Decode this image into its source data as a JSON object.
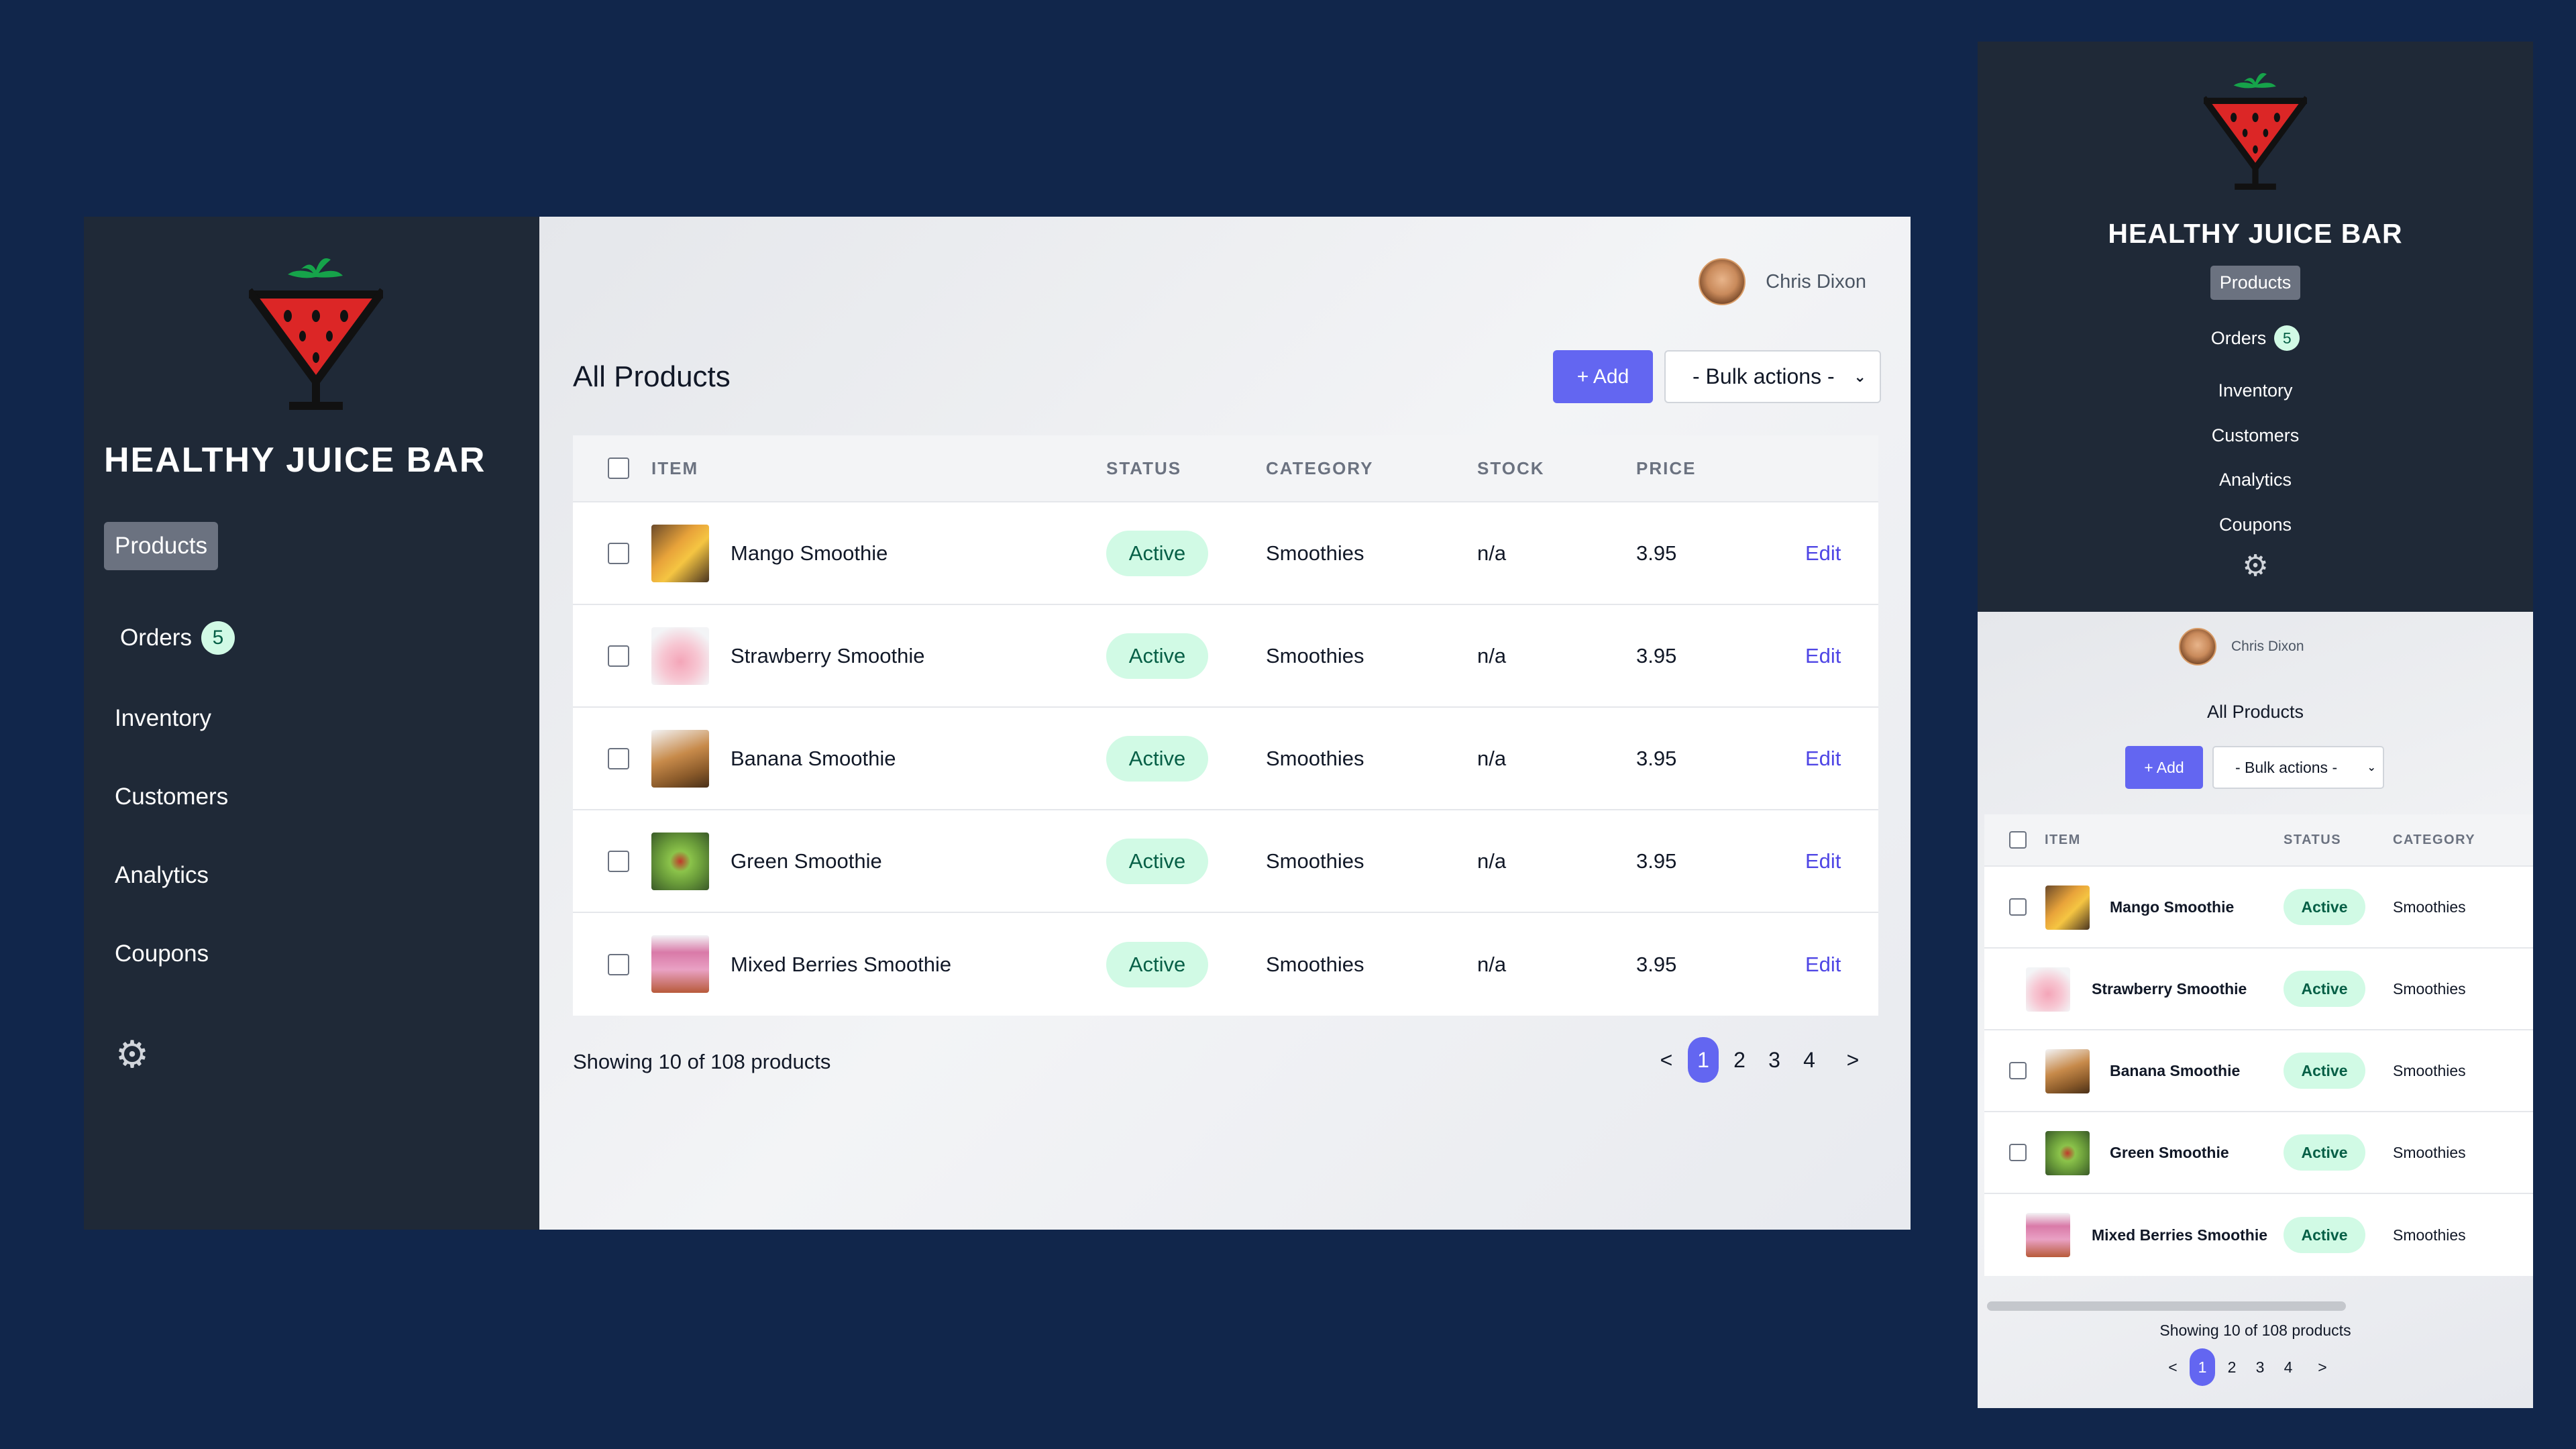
{
  "brand": {
    "name": "HEALTHY JUICE BAR"
  },
  "nav": {
    "items": [
      {
        "label": "Products",
        "active": true
      },
      {
        "label": "Orders",
        "badge": "5"
      },
      {
        "label": "Inventory"
      },
      {
        "label": "Customers"
      },
      {
        "label": "Analytics"
      },
      {
        "label": "Coupons"
      }
    ],
    "settings_icon": "gear-icon"
  },
  "user": {
    "name": "Chris Dixon"
  },
  "page": {
    "title": "All Products",
    "add_label": "+ Add",
    "bulk_actions_label": "- Bulk actions -"
  },
  "table": {
    "headers": {
      "item": "ITEM",
      "status": "STATUS",
      "category": "CATEGORY",
      "stock": "STOCK",
      "price": "PRICE"
    },
    "rows": [
      {
        "name": "Mango Smoothie",
        "status": "Active",
        "category": "Smoothies",
        "stock": "n/a",
        "price": "3.95",
        "action": "Edit"
      },
      {
        "name": "Strawberry Smoothie",
        "status": "Active",
        "category": "Smoothies",
        "stock": "n/a",
        "price": "3.95",
        "action": "Edit"
      },
      {
        "name": "Banana Smoothie",
        "status": "Active",
        "category": "Smoothies",
        "stock": "n/a",
        "price": "3.95",
        "action": "Edit"
      },
      {
        "name": "Green Smoothie",
        "status": "Active",
        "category": "Smoothies",
        "stock": "n/a",
        "price": "3.95",
        "action": "Edit"
      },
      {
        "name": "Mixed Berries Smoothie",
        "status": "Active",
        "category": "Smoothies",
        "stock": "n/a",
        "price": "3.95",
        "action": "Edit"
      }
    ]
  },
  "footer": {
    "summary": "Showing 10 of 108 products",
    "pagination": {
      "prev": "<",
      "pages": [
        "1",
        "2",
        "3",
        "4"
      ],
      "current": "1",
      "next": ">"
    }
  },
  "colors": {
    "background": "#11264b",
    "sidebar": "#1f2937",
    "accent": "#6366f1",
    "active_pill": "#d1fae5",
    "active_pill_text": "#065f46",
    "logo_red": "#dc2626",
    "logo_leaf": "#16a34a"
  }
}
